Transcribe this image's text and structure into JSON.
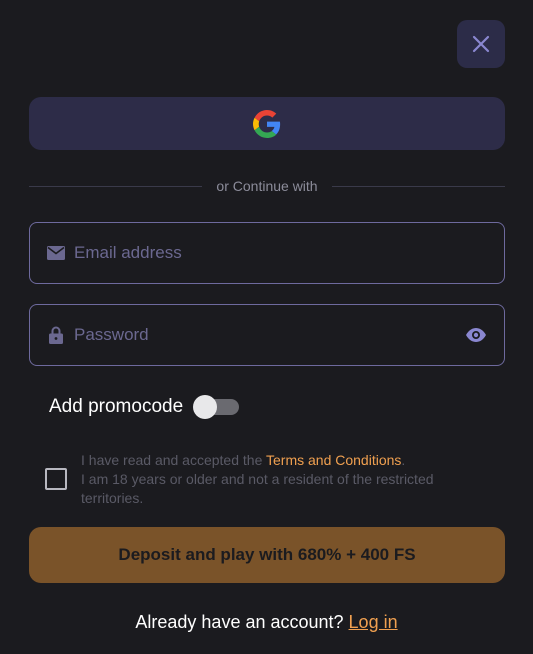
{
  "close": {
    "icon": "close-icon"
  },
  "google": {
    "icon": "google-icon"
  },
  "divider": {
    "text": "or Continue with"
  },
  "email": {
    "placeholder": "Email address",
    "value": "",
    "icon": "envelope-icon"
  },
  "password": {
    "placeholder": "Password",
    "value": "",
    "icon": "lock-icon",
    "toggle_icon": "eye-icon"
  },
  "promo": {
    "label": "Add promocode",
    "enabled": false
  },
  "terms": {
    "checked": false,
    "prefix": "I have read and accepted the ",
    "link": "Terms and Conditions",
    "suffix": ".",
    "line2": "I am 18 years or older and not a resident of the restricted territories."
  },
  "deposit": {
    "label": "Deposit and play with 680% + 400 FS"
  },
  "footer": {
    "prompt": "Already have an account? ",
    "link": "Log in"
  },
  "colors": {
    "background": "#1b1b1f",
    "accent": "#f0a050",
    "button": "#7a5329",
    "field_border": "#6e6a9e",
    "secondary_button": "#2d2c48"
  }
}
